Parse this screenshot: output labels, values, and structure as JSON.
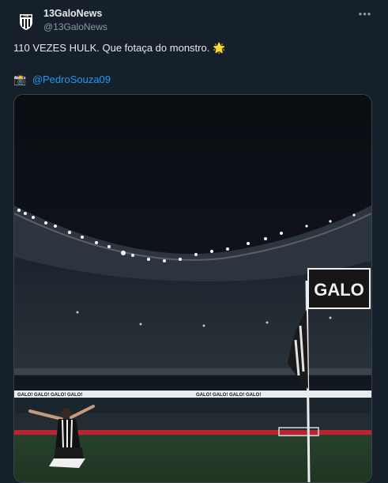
{
  "account": {
    "name": "13GaloNews",
    "handle": "@13GaloNews",
    "avatar_text": "CAM"
  },
  "menu": {
    "more_label": "•••"
  },
  "tweet": {
    "text": "110 VEZES HULK. Que fotaça do monstro. 🌟",
    "credit_icon": "📸",
    "credit_mention": "@PedroSouza09"
  },
  "media": {
    "flag_text": "GALO",
    "board_text": "GALO! GALO! GALO! GALO!",
    "accent": "#1d9bf0"
  }
}
